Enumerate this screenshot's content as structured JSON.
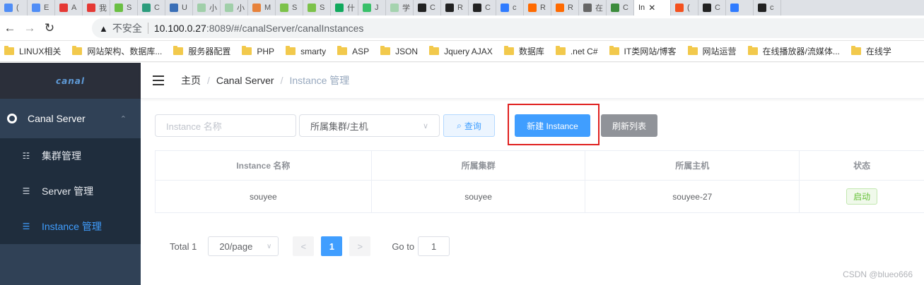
{
  "browser": {
    "tabs": [
      {
        "label": "(",
        "color": "#4f8df6"
      },
      {
        "label": "E",
        "color": "#4f8df6"
      },
      {
        "label": "A",
        "color": "#e53935"
      },
      {
        "label": "我",
        "color": "#e53935"
      },
      {
        "label": "S",
        "color": "#6abf43"
      },
      {
        "label": "C",
        "color": "#2b9c7c"
      },
      {
        "label": "U",
        "color": "#3a6fb7"
      },
      {
        "label": "小",
        "color": "#a0cfa9"
      },
      {
        "label": "小",
        "color": "#a0cfa9"
      },
      {
        "label": "M",
        "color": "#e7823b"
      },
      {
        "label": "S",
        "color": "#7cc24a"
      },
      {
        "label": "S",
        "color": "#7cc24a"
      },
      {
        "label": "什",
        "color": "#11a95d"
      },
      {
        "label": "J",
        "color": "#39c06a"
      },
      {
        "label": "学",
        "color": "#a5d3af"
      },
      {
        "label": "C",
        "color": "#222222"
      },
      {
        "label": "R",
        "color": "#222222"
      },
      {
        "label": "C",
        "color": "#222222"
      },
      {
        "label": "c",
        "color": "#2f7bff"
      },
      {
        "label": "R",
        "color": "#ff6a00"
      },
      {
        "label": "R",
        "color": "#ff6a00"
      },
      {
        "label": "在",
        "color": "#666666"
      },
      {
        "label": "C",
        "color": "#3c8c3c"
      }
    ],
    "active_tab": {
      "label": "In",
      "close": "✕"
    },
    "tabs_after": [
      {
        "label": "(",
        "color": "#f4511e"
      },
      {
        "label": "C",
        "color": "#222222"
      },
      {
        "label": "",
        "color": "#2f7bff"
      },
      {
        "label": "c",
        "color": "#222222"
      }
    ],
    "address": {
      "warning_icon": "▲",
      "insecure_label": "不安全",
      "host": "10.100.0.27",
      "path": ":8089/#/canalServer/canalInstances"
    },
    "nav": {
      "back": "←",
      "forward": "→",
      "reload": "↻"
    },
    "bookmarks": [
      "LINUX相关",
      "网站架构、数据库...",
      "服务器配置",
      "PHP",
      "smarty",
      "ASP",
      "JSON",
      "Jquery AJAX",
      "数据库",
      ".net C#",
      "IT类网站/博客",
      "网站运营",
      "在线播放器/流媒体...",
      "在线学"
    ]
  },
  "sidebar": {
    "logo": "canal",
    "parent": {
      "label": "Canal Server",
      "chevron": "⌃"
    },
    "items": [
      {
        "label": "集群管理",
        "icon": "☷"
      },
      {
        "label": "Server 管理",
        "icon": "☰"
      },
      {
        "label": "Instance 管理",
        "icon": "☰"
      }
    ]
  },
  "header": {
    "breadcrumb": {
      "home": "主页",
      "section": "Canal Server",
      "current": "Instance 管理",
      "separator": "/"
    }
  },
  "filters": {
    "name_placeholder": "Instance 名称",
    "cluster_select": "所属集群/主机",
    "select_arrow": "∨",
    "search_icon": "⌕",
    "search_label": "查询",
    "new_label": "新建 Instance",
    "refresh_label": "刷新列表"
  },
  "table": {
    "headers": [
      "Instance 名称",
      "所属集群",
      "所属主机",
      "状态"
    ],
    "rows": [
      {
        "name": "souyee",
        "cluster": "souyee",
        "host": "souyee-27",
        "status": "启动"
      }
    ]
  },
  "pagination": {
    "total": "Total 1",
    "page_size": "20/page",
    "prev": "<",
    "page": "1",
    "next": ">",
    "goto_label": "Go to",
    "goto_value": "1"
  },
  "watermark": "CSDN @blueo666",
  "colors": {
    "primary": "#409eff",
    "sidebar": "#304156",
    "highlight": "#e0201f",
    "success": "#67c23a"
  }
}
